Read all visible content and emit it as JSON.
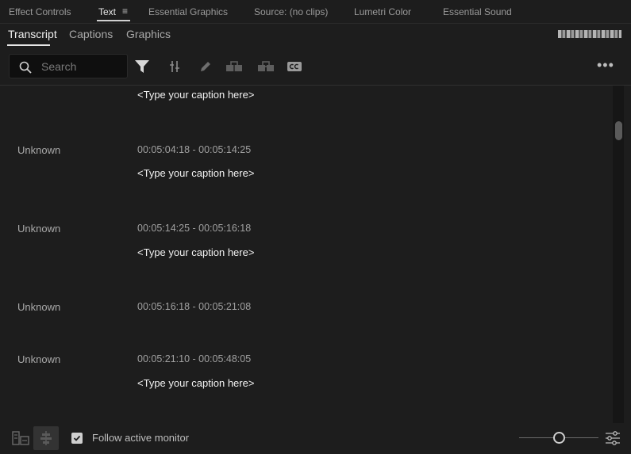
{
  "panel_tabs": [
    {
      "label": "Effect Controls",
      "active": false
    },
    {
      "label": "Text",
      "active": true
    },
    {
      "label": "Essential Graphics",
      "active": false
    },
    {
      "label": "Source: (no clips)",
      "active": false
    },
    {
      "label": "Lumetri Color",
      "active": false
    },
    {
      "label": "Essential Sound",
      "active": false
    }
  ],
  "sub_tabs": [
    {
      "label": "Transcript",
      "active": true
    },
    {
      "label": "Captions",
      "active": false
    },
    {
      "label": "Graphics",
      "active": false
    }
  ],
  "search": {
    "placeholder": "Search",
    "value": ""
  },
  "toolbar_icons": [
    "filter-icon",
    "split-icon",
    "pencil-icon",
    "merge-icon",
    "split-segment-icon",
    "cc-icon"
  ],
  "segments": [
    {
      "caption": "<Type your caption here>"
    },
    {
      "speaker": "Unknown",
      "timecode": "00:05:04:18 - 00:05:14:25",
      "caption": "<Type your caption here>"
    },
    {
      "speaker": "Unknown",
      "timecode": "00:05:14:25 - 00:05:16:18",
      "caption": "<Type your caption here>"
    },
    {
      "speaker": "Unknown",
      "timecode": "00:05:16:18 - 00:05:21:08"
    },
    {
      "speaker": "Unknown",
      "timecode": "00:05:21:10 - 00:05:48:05",
      "caption": "<Type your caption here>"
    }
  ],
  "footer": {
    "follow_label": "Follow active monitor",
    "follow_checked": true
  },
  "colors": {
    "background": "#1d1d1d",
    "toolbar_bg": "#0f0f0f",
    "text_primary": "#f2f2f2",
    "text_secondary": "#a0a0a0"
  }
}
